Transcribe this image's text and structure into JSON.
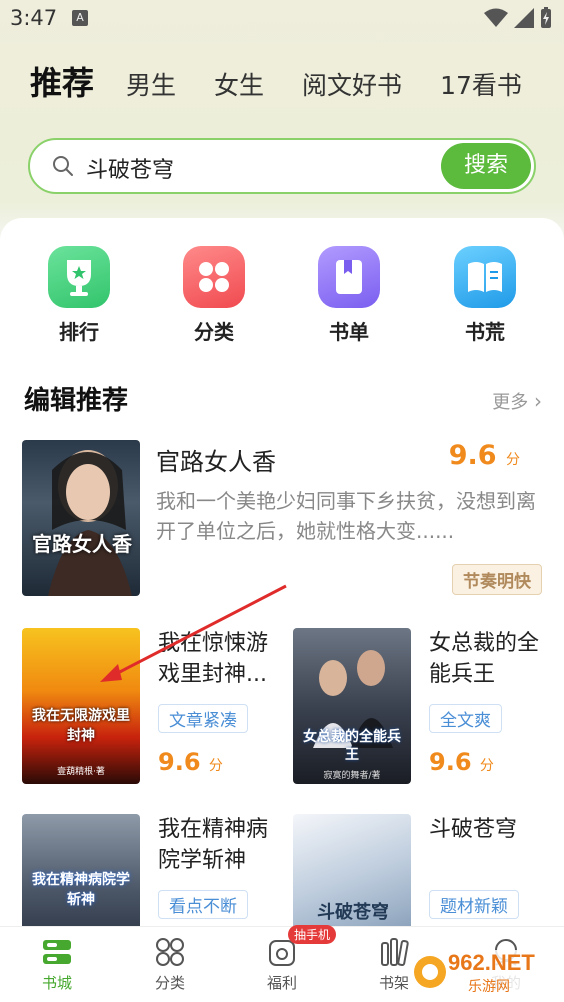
{
  "status_bar": {
    "time": "3:47",
    "notification_icon": "A"
  },
  "top_tabs": [
    {
      "label": "推荐",
      "active": true
    },
    {
      "label": "男生",
      "active": false
    },
    {
      "label": "女生",
      "active": false
    },
    {
      "label": "阅文好书",
      "active": false
    },
    {
      "label": "17看书",
      "active": false
    }
  ],
  "search": {
    "value": "斗破苍穹",
    "button_label": "搜索"
  },
  "quick_nav": [
    {
      "label": "排行",
      "icon": "trophy-icon",
      "color": "#3ecf7a"
    },
    {
      "label": "分类",
      "icon": "grid-icon",
      "color": "#f2565a"
    },
    {
      "label": "书单",
      "icon": "book-list-icon",
      "color": "#8a6cf2"
    },
    {
      "label": "书荒",
      "icon": "open-book-icon",
      "color": "#2fa8f0"
    }
  ],
  "section": {
    "title": "编辑推荐",
    "more_label": "更多"
  },
  "featured_book": {
    "title": "官路女人香",
    "score": "9.6",
    "score_unit": "分",
    "description": "我和一个美艳少妇同事下乡扶贫，没想到离开了单位之后，她就性格大变......",
    "tag": "节奏明快",
    "cover_text": "官路女人香"
  },
  "grid_books": [
    {
      "title": "我在惊悚游戏里封神...",
      "tag": "文章紧凑",
      "score": "9.6",
      "score_unit": "分",
      "cover_text": "我在无限游戏里封神",
      "cover_author": "壹葫精根·著"
    },
    {
      "title": "女总裁的全能兵王",
      "tag": "全文爽",
      "score": "9.6",
      "score_unit": "分",
      "cover_text": "女总裁的全能兵王",
      "cover_author": "寂寞的舞者/著"
    },
    {
      "title": "我在精神病院学斩神",
      "tag": "看点不断",
      "score": "",
      "score_unit": "",
      "cover_text": "我在精神病院学斩神",
      "cover_author": ""
    },
    {
      "title": "斗破苍穹",
      "tag": "题材新颖",
      "score": "",
      "score_unit": "",
      "cover_text": "斗破苍穹",
      "cover_author": ""
    }
  ],
  "bottom_nav": [
    {
      "label": "书城",
      "icon": "bookstore-icon",
      "active": true
    },
    {
      "label": "分类",
      "icon": "category-icon",
      "active": false
    },
    {
      "label": "福利",
      "icon": "welfare-icon",
      "active": false
    },
    {
      "label": "书架",
      "icon": "bookshelf-icon",
      "active": false
    },
    {
      "label": "我的",
      "icon": "profile-icon",
      "active": false
    }
  ],
  "badge": {
    "label": "抽手机"
  },
  "watermark": {
    "text": "962.NET",
    "subtext": "乐游网"
  },
  "colors": {
    "accent": "#5cba3c",
    "score": "#f08a1d",
    "tag_blue": "#4a8ed6"
  }
}
